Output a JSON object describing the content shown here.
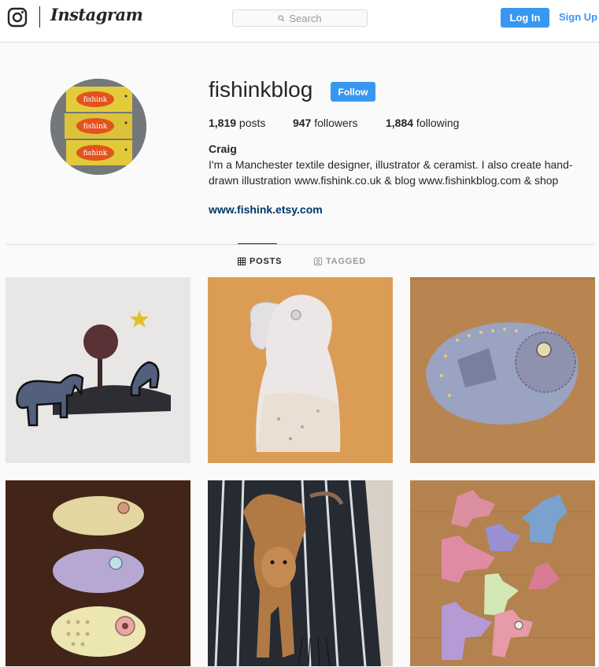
{
  "nav": {
    "brand": "Instagram",
    "search_placeholder": "Search",
    "login_label": "Log In",
    "signup_label": "Sign Up",
    "icons": {
      "logo": "instagram-camera-icon",
      "search": "search-icon"
    }
  },
  "profile": {
    "username": "fishinkblog",
    "follow_label": "Follow",
    "posts_count": "1,819",
    "posts_label": " posts",
    "followers_count": "947",
    "followers_label": " followers",
    "following_count": "1,884",
    "following_label": " following",
    "full_name": "Craig",
    "bio": "I'm a Manchester textile designer, illustrator & ceramist. I also create hand-drawn illustration www.fishink.co.uk & blog www.fishinkblog.com & shop",
    "website": "www.fishink.etsy.com",
    "avatar_tag_text": "fishink"
  },
  "tabs": [
    {
      "label": "POSTS",
      "icon": "grid-icon",
      "active": true
    },
    {
      "label": "TAGGED",
      "icon": "tag-icon",
      "active": false
    }
  ],
  "posts": [
    {
      "subject": "elephants-tree-star-illustration"
    },
    {
      "subject": "ceramic-elephant-figure"
    },
    {
      "subject": "ceramic-fish-plate"
    },
    {
      "subject": "three-ceramic-fish"
    },
    {
      "subject": "greyhound-on-rug"
    },
    {
      "subject": "ceramic-dog-heads"
    }
  ],
  "colors": {
    "accent": "#3897f0",
    "link": "#003569",
    "text": "#262626",
    "muted": "#999999",
    "border": "#dbdbdb",
    "background": "#fafafa"
  }
}
